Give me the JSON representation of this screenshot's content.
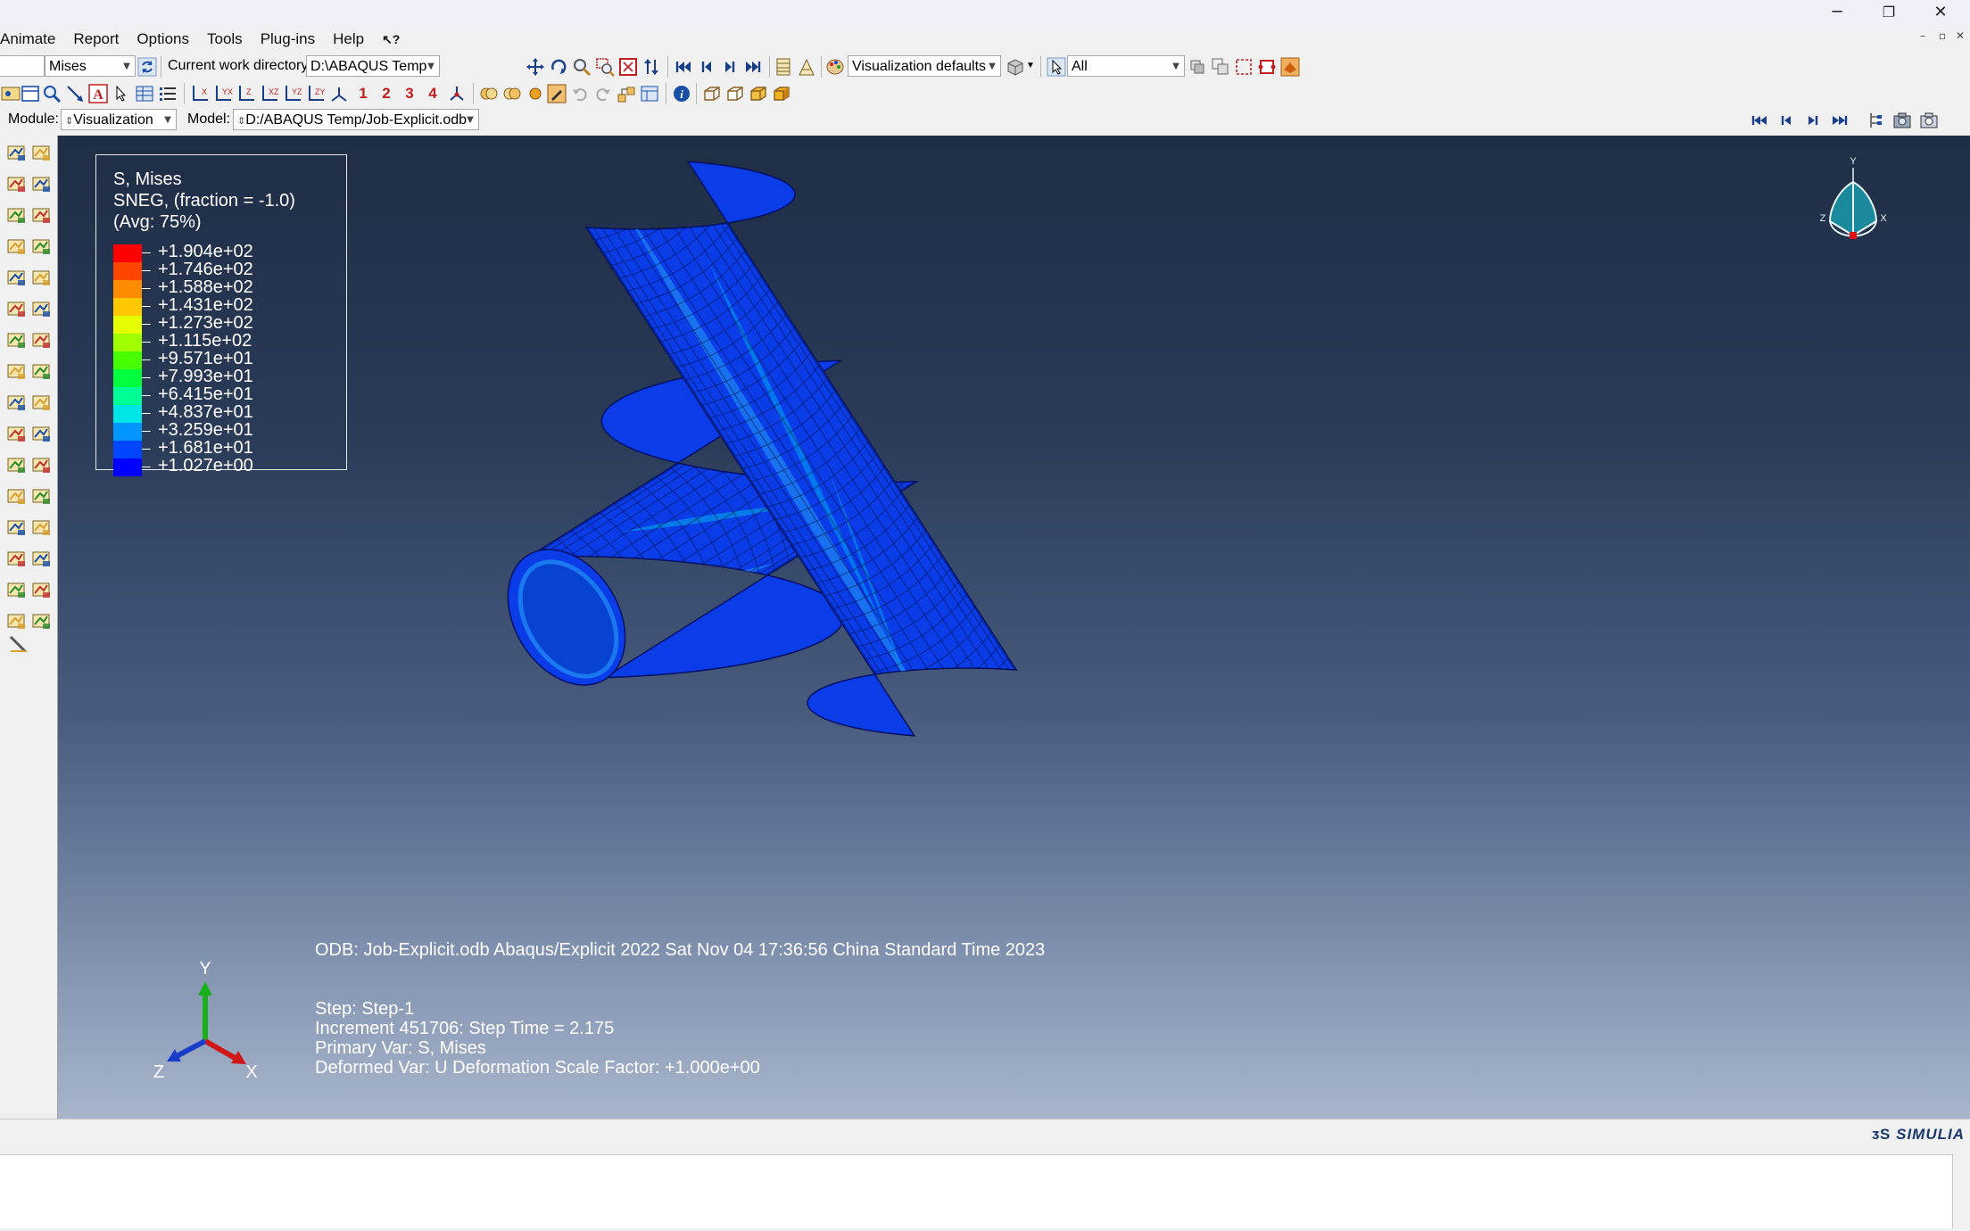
{
  "window": {
    "minimize": "─",
    "restore": "❐",
    "close": "✕",
    "mdi_minimize": "–",
    "mdi_restore": "▫",
    "mdi_close": "✕"
  },
  "menu": {
    "items": [
      "Animate",
      "Report",
      "Options",
      "Tools",
      "Plug-ins",
      "Help"
    ],
    "context_help_icon": "context-help-icon"
  },
  "toolbar1": {
    "variable_value": "Mises",
    "workdir_label": "Current work directory:",
    "workdir_value": "D:\\ABAQUS Temp",
    "view_defaults_value": "Visualization defaults",
    "selection_value": "All"
  },
  "toolbar2": {
    "numbered_buttons": [
      "1",
      "2",
      "3",
      "4"
    ]
  },
  "context_bar": {
    "module_label": "Module:",
    "module_value": "Visualization",
    "model_label": "Model:",
    "model_value": "D:/ABAQUS Temp/Job-Explicit.odb"
  },
  "legend": {
    "title1": "S, Mises",
    "title2": "SNEG, (fraction = -1.0)",
    "title3": "(Avg: 75%)",
    "values": [
      "+1.904e+02",
      "+1.746e+02",
      "+1.588e+02",
      "+1.431e+02",
      "+1.273e+02",
      "+1.115e+02",
      "+9.571e+01",
      "+7.993e+01",
      "+6.415e+01",
      "+4.837e+01",
      "+3.259e+01",
      "+1.681e+01",
      "+1.027e+00"
    ],
    "colors": [
      "#ff0000",
      "#ff4600",
      "#ff8c00",
      "#ffc800",
      "#e6ff00",
      "#a0ff00",
      "#46ff00",
      "#00ff3c",
      "#00ff96",
      "#00e6e6",
      "#0096ff",
      "#0046ff",
      "#0000ff"
    ]
  },
  "info": {
    "odb_line": "ODB: Job-Explicit.odb    Abaqus/Explicit 2022    Sat Nov 04 17:36:56 China Standard Time 2023",
    "step_line": "Step: Step-1",
    "increment_line": "Increment    451706: Step Time =     2.175",
    "primary_line": "Primary Var: S, Mises",
    "deformed_line": "Deformed Var: U   Deformation Scale Factor: +1.000e+00"
  },
  "triad": {
    "y": "Y",
    "z": "Z",
    "x": "X"
  },
  "mini_triad": {
    "y": "Y",
    "z": "Z",
    "x": "X"
  },
  "brand": "SIMULIA",
  "colors": {
    "viewport_top": "#1f2d45",
    "viewport_bottom": "#a8b5cb",
    "mesh_blue": "#0a36e6"
  }
}
